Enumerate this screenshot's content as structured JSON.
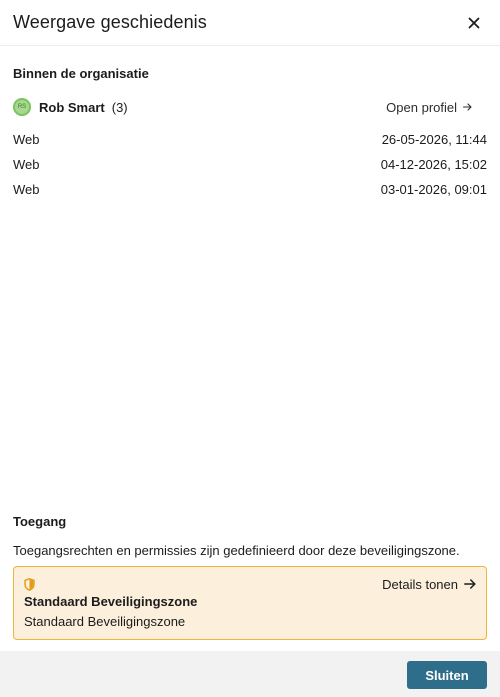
{
  "dialog": {
    "title": "Weergave geschiedenis",
    "close_icon": "close-icon"
  },
  "organization": {
    "heading": "Binnen de organisatie",
    "user": {
      "avatar_initials": "RS",
      "name": "Rob Smart",
      "count": "(3)",
      "open_profile_label": "Open profiel",
      "open_profile_icon": "arrow-right-icon"
    },
    "history": [
      {
        "source": "Web",
        "datetime": "26-05-2026, 11:44"
      },
      {
        "source": "Web",
        "datetime": "04-12-2026, 15:02"
      },
      {
        "source": "Web",
        "datetime": "03-01-2026, 09:01"
      }
    ]
  },
  "access": {
    "heading": "Toegang",
    "description": "Toegangsrechten en permissies zijn gedefinieerd door deze beveiligingszone.",
    "zone": {
      "icon": "shield-icon",
      "details_label": "Details tonen",
      "details_icon": "arrow-right-icon",
      "name": "Standaard Beveiligingszone",
      "subtitle": "Standaard Beveiligingszone"
    }
  },
  "footer": {
    "close_label": "Sluiten"
  },
  "colors": {
    "primary_button": "#2e6e8a",
    "zone_background": "#fcf0dd",
    "zone_border": "#f0b43c",
    "avatar": "#a6d98f"
  }
}
